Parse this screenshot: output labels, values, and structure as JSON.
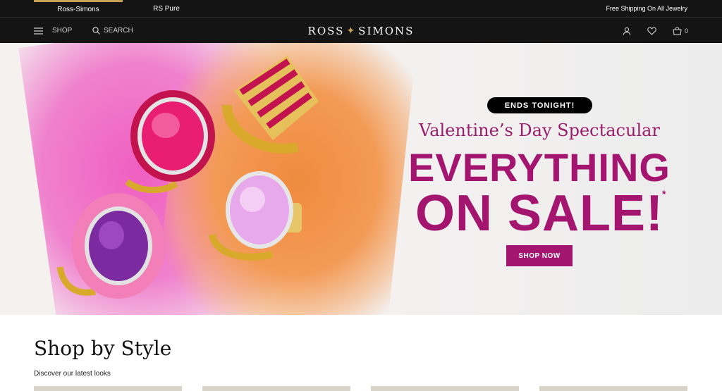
{
  "topbar": {
    "sites": [
      "Ross-Simons",
      "RS Pure"
    ],
    "shipping_text": "Free Shipping On All Jewelry"
  },
  "header": {
    "shop_label": "SHOP",
    "search_label": "SEARCH",
    "logo_left": "ROSS",
    "logo_right": "SIMONS",
    "bag_count": "0"
  },
  "hero": {
    "badge": "ENDS TONIGHT!",
    "subtitle": "Valentine’s Day Spectacular",
    "headline_line1": "EVERYTHING",
    "headline_line2": "ON SALE!",
    "asterisk": "*",
    "cta": "SHOP NOW"
  },
  "section": {
    "title": "Shop by Style",
    "subtitle": "Discover our latest looks"
  },
  "colors": {
    "topbar_bg": "#141414",
    "accent_gold": "#c9a25a",
    "brand_magenta": "#a3156f"
  }
}
